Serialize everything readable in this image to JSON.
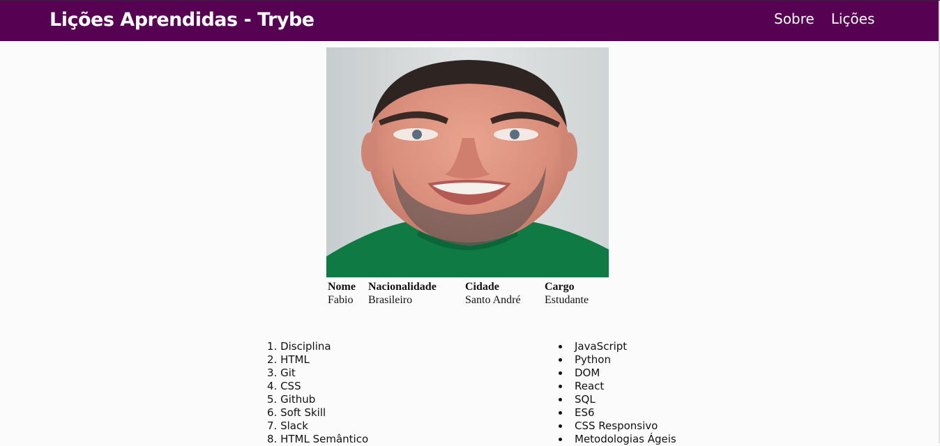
{
  "header": {
    "title": "Lições Aprendidas - Trybe",
    "nav": [
      "Sobre",
      "Lições"
    ]
  },
  "profile": {
    "photo_icon": "person-photo",
    "headers": [
      "Nome",
      "Nacionalidade",
      "Cidade",
      "Cargo"
    ],
    "values": [
      "Fabio",
      "Brasileiro",
      "Santo André",
      "Estudante"
    ]
  },
  "ordered": [
    "1. Disciplina",
    "2. HTML",
    "3. Git",
    "4. CSS",
    "5. Github",
    "6. Soft Skill",
    "7. Slack",
    "8. HTML Semântico"
  ],
  "unordered": [
    "JavaScript",
    "Python",
    "DOM",
    "React",
    "SQL",
    "ES6",
    "CSS Responsivo",
    "Metodologias Ágeis"
  ],
  "colors": {
    "header_bg": "#570152",
    "header_text": "#ffffff"
  }
}
